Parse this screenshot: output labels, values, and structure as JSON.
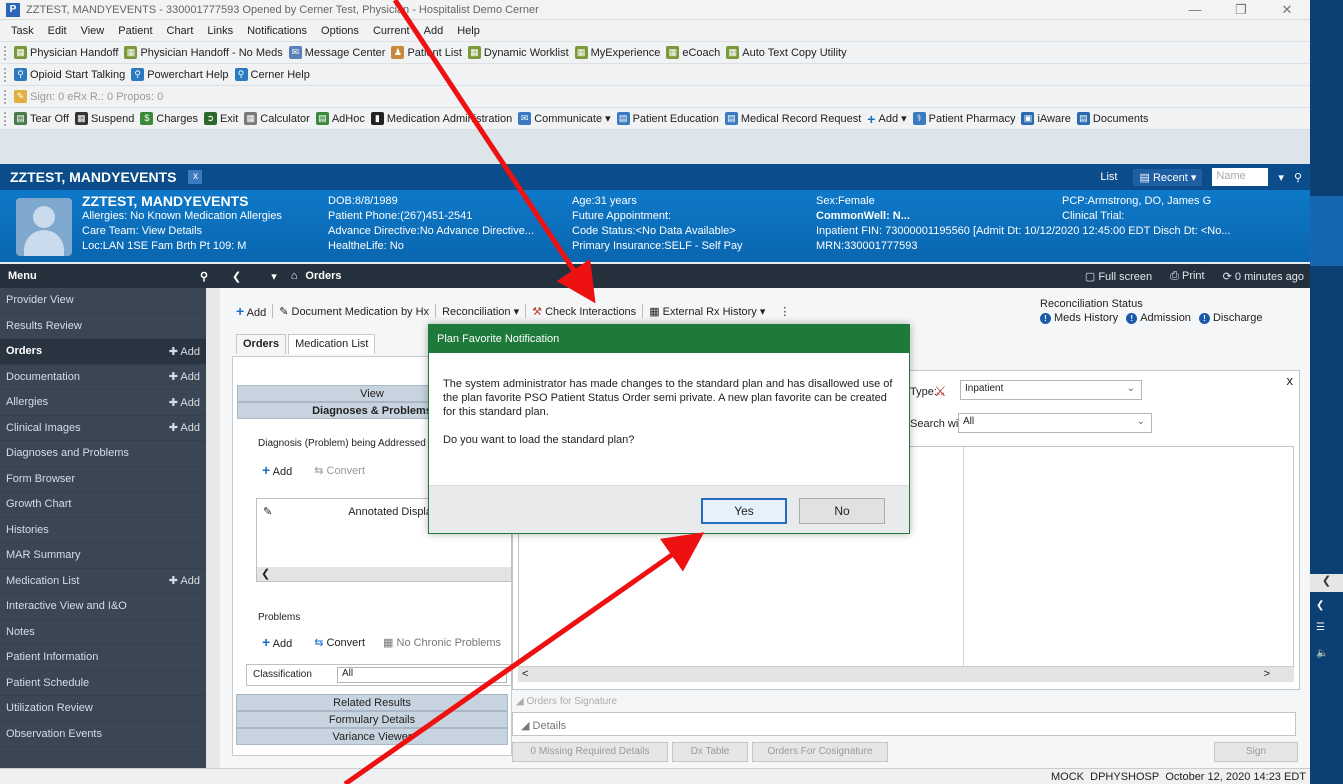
{
  "window": {
    "title": "ZZTEST, MANDYEVENTS - 330001777593 Opened by Cerner Test, Physician - Hospitalist Demo Cerner",
    "app_icon": "P"
  },
  "menubar": [
    "Task",
    "Edit",
    "View",
    "Patient",
    "Chart",
    "Links",
    "Notifications",
    "Options",
    "Current",
    "Add",
    "Help"
  ],
  "toolbar1": [
    "Physician Handoff",
    "Physician Handoff - No Meds",
    "Message Center",
    "Patient List",
    "Dynamic Worklist",
    "MyExperience",
    "eCoach",
    "Auto Text Copy Utility"
  ],
  "toolbar2": [
    "Opioid Start Talking",
    "Powerchart Help",
    "Cerner Help"
  ],
  "toolbar3": "Sign: 0  eRx R.: 0  Propos: 0",
  "toolbar4": [
    "Tear Off",
    "Suspend",
    "Charges",
    "Exit",
    "Calculator",
    "AdHoc",
    "Medication Administration",
    "Communicate",
    "Patient Education",
    "Medical Record Request",
    "Add",
    "Patient Pharmacy",
    "iAware",
    "Documents"
  ],
  "patient_tab": {
    "name": "ZZTEST, MANDYEVENTS",
    "close": "x",
    "list": "List",
    "recent": "Recent",
    "search_placeholder": "Name"
  },
  "banner": {
    "name": "ZZTEST, MANDYEVENTS",
    "allergies": "Allergies: No Known Medication Allergies",
    "care_team": "Care Team: View Details",
    "loc": "Loc:LAN 1SE Fam Brth Pt 109: M",
    "dob": "DOB:8/8/1989",
    "phone": "Patient Phone:(267)451-2541",
    "advance_directive": "Advance Directive:No Advance Directive...",
    "healthelife": "HealtheLife: No",
    "age": "Age:31 years",
    "future_appt": "Future Appointment:",
    "code_status": "Code Status:<No Data Available>",
    "insurance": "Primary Insurance:SELF - Self Pay",
    "sex": "Sex:Female",
    "commonwell": "CommonWell: N...",
    "fin": "Inpatient FIN: 73000001195560 [Admit Dt: 10/12/2020 12:45:00 EDT Disch Dt: <No...",
    "mrn": "MRN:330001777593",
    "pcp": "PCP:Armstrong, DO, James G",
    "clinical_trial": "Clinical Trial:"
  },
  "menu_label": "Menu",
  "sidebar": [
    {
      "label": "Provider View",
      "add": ""
    },
    {
      "label": "Results Review",
      "add": ""
    },
    {
      "label": "Orders",
      "add": "Add",
      "active": true
    },
    {
      "label": "Documentation",
      "add": "Add"
    },
    {
      "label": "Allergies",
      "add": "Add"
    },
    {
      "label": "Clinical Images",
      "add": "Add"
    },
    {
      "label": "Diagnoses and Problems",
      "add": ""
    },
    {
      "label": "Form Browser",
      "add": ""
    },
    {
      "label": "Growth Chart",
      "add": ""
    },
    {
      "label": "Histories",
      "add": ""
    },
    {
      "label": "MAR Summary",
      "add": ""
    },
    {
      "label": "Medication List",
      "add": "Add"
    },
    {
      "label": "Interactive View and I&O",
      "add": ""
    },
    {
      "label": "Notes",
      "add": ""
    },
    {
      "label": "Patient Information",
      "add": ""
    },
    {
      "label": "Patient Schedule",
      "add": ""
    },
    {
      "label": "Utilization Review",
      "add": ""
    },
    {
      "label": "Observation Events",
      "add": ""
    }
  ],
  "content_nav": {
    "title": "Orders",
    "fullscreen": "Full screen",
    "print": "Print",
    "refresh": "0 minutes ago"
  },
  "orders_toolbar": {
    "add": "Add",
    "doc_med": "Document Medication by Hx",
    "reconciliation": "Reconciliation",
    "check_interactions": "Check Interactions",
    "external_rx": "External Rx History"
  },
  "reconciliation_status": {
    "label": "Reconciliation Status",
    "meds_history": "Meds History",
    "admission": "Admission",
    "discharge": "Discharge"
  },
  "tabs": [
    "Orders",
    "Medication List"
  ],
  "left_panel": {
    "view": "View",
    "diag_header": "Diagnoses & Problems",
    "diag_label": "Diagnosis (Problem) being Addressed this Visit",
    "add": "Add",
    "convert": "Convert",
    "annotated": "Annotated Display",
    "problems": "Problems",
    "no_chronic": "No Chronic Problems",
    "classification_label": "Classification",
    "classification_value": "All",
    "related_results": "Related Results",
    "formulary_details": "Formulary Details",
    "variance_viewer": "Variance Viewer"
  },
  "right_panel": {
    "type_label": "Type:",
    "type_value": "Inpatient",
    "search_within_label": "Search within:",
    "search_within_value": "All",
    "orders_for_signature": "Orders for Signature",
    "details": "Details",
    "close": "x",
    "scroll_left": "<",
    "scroll_right": ">"
  },
  "bottom_buttons": [
    "0 Missing Required Details",
    "Dx Table",
    "Orders For Cosignature",
    "Sign"
  ],
  "modal": {
    "title": "Plan Favorite Notification",
    "message": "The system administrator has made changes to the standard plan and has disallowed use of the plan favorite PSO Patient Status Order semi private. A new plan favorite can be created for this standard plan.",
    "question": "Do you want to load the standard plan?",
    "yes": "Yes",
    "no": "No"
  },
  "statusbar": {
    "mock": "MOCK",
    "user": "DPHYSHOSP",
    "datetime": "October 12, 2020  14:23 EDT"
  },
  "colors": {
    "banner": "#0a66b0",
    "nav_dark": "#24303c",
    "sidebar": "#3a4654",
    "modal_header": "#1d7a3a",
    "arrow": "#ee1111"
  }
}
